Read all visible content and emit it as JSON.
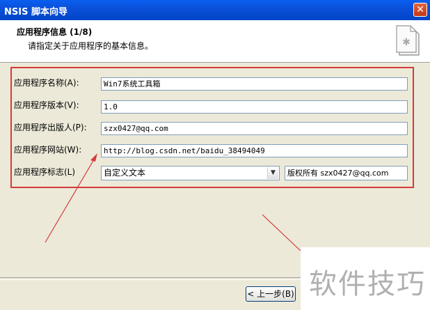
{
  "window": {
    "title": "NSIS 脚本向导"
  },
  "header": {
    "title": "应用程序信息 (1/8)",
    "subtitle": "请指定关于应用程序的基本信息。"
  },
  "fields": [
    {
      "label": "应用程序名称(A):",
      "value": "Win7系统工具箱"
    },
    {
      "label": "应用程序版本(V):",
      "value": "1.0"
    },
    {
      "label": "应用程序出版人(P):",
      "value": "szx0427@qq.com"
    },
    {
      "label": "应用程序网站(W):",
      "value": "http://blog.csdn.net/baidu_38494049"
    },
    {
      "label": "应用程序标志(L)",
      "select_value": "自定义文本",
      "text_value": "版权所有 szx0427@qq.com"
    }
  ],
  "buttons": {
    "back": "< 上一步(B)"
  },
  "watermark": {
    "text": "软件技巧"
  },
  "colors": {
    "annotation": "#d43a3a",
    "titlebar": "#0a4fd8"
  }
}
